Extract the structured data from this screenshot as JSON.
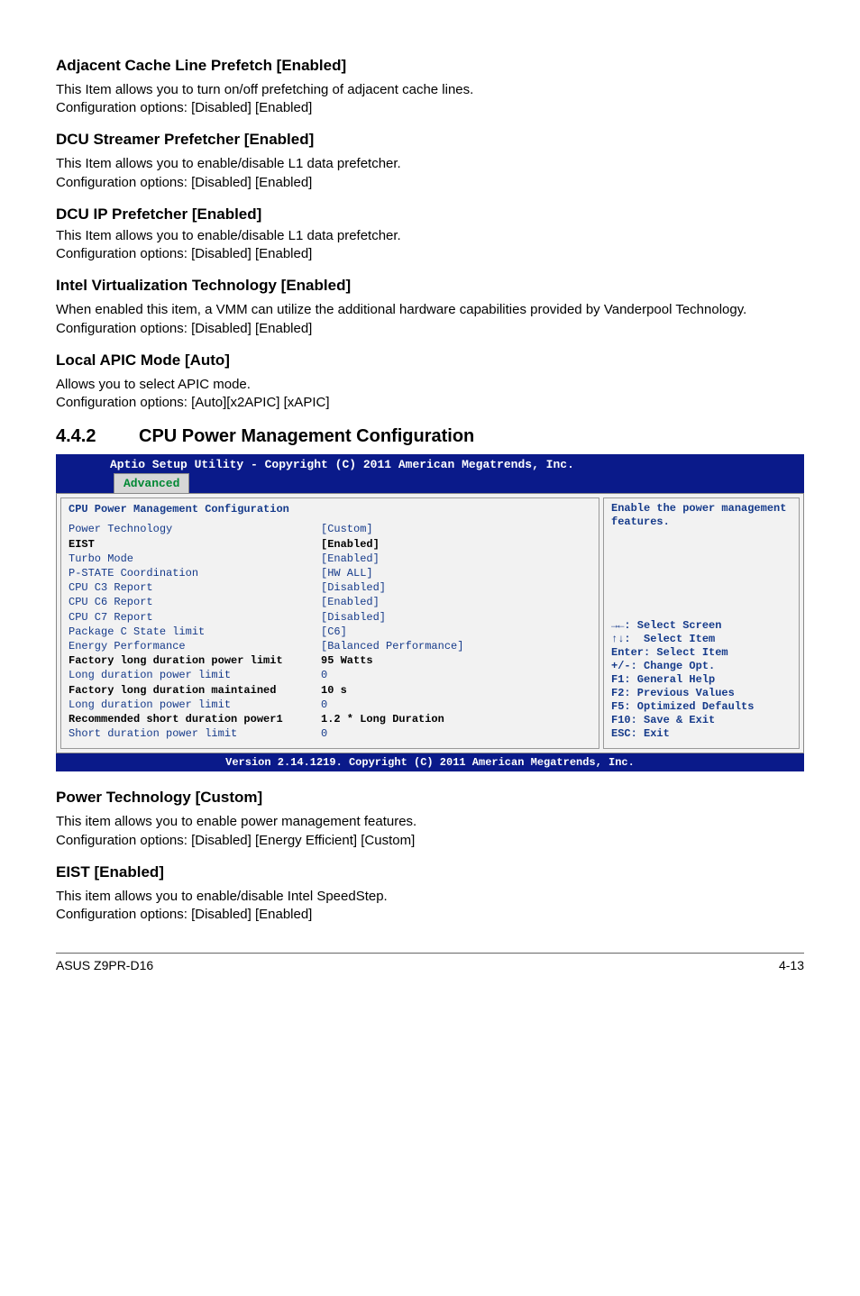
{
  "s1": {
    "h": "Adjacent Cache Line Prefetch [Enabled]",
    "p": "This Item allows you to turn on/off prefetching of adjacent cache lines.\nConfiguration options: [Disabled] [Enabled]"
  },
  "s2": {
    "h": "DCU Streamer Prefetcher [Enabled]",
    "p": "This Item allows you to enable/disable L1 data prefetcher.\nConfiguration options: [Disabled] [Enabled]"
  },
  "s3": {
    "h": "DCU IP Prefetcher [Enabled]",
    "p": "This Item allows you to enable/disable L1 data prefetcher.\nConfiguration options: [Disabled] [Enabled]"
  },
  "s4": {
    "h": "Intel Virtualization Technology [Enabled]",
    "p": "When enabled this item, a VMM can utilize the additional hardware capabilities provided by Vanderpool Technology.\nConfiguration options: [Disabled] [Enabled]"
  },
  "s5": {
    "h": "Local APIC Mode [Auto]",
    "p": "Allows you to select APIC mode.\nConfiguration options: [Auto][x2APIC] [xAPIC]"
  },
  "sec": {
    "num": "4.4.2",
    "title": "CPU Power Management Configuration"
  },
  "bios": {
    "top": "Aptio Setup Utility - Copyright (C) 2011 American Megatrends, Inc.",
    "tab": "Advanced",
    "panel_title": "CPU Power Management Configuration",
    "rows": [
      {
        "k": "Power Technology",
        "v": "[Custom]",
        "cls": "blue"
      },
      {
        "k": "EIST",
        "v": "[Enabled]",
        "cls": "boldline"
      },
      {
        "k": "Turbo Mode",
        "v": "[Enabled]",
        "cls": "blue"
      },
      {
        "k": "P-STATE Coordination",
        "v": "[HW ALL]",
        "cls": "blue"
      },
      {
        "k": "CPU C3 Report",
        "v": "[Disabled]",
        "cls": "blue"
      },
      {
        "k": "CPU C6 Report",
        "v": "[Enabled]",
        "cls": "blue"
      },
      {
        "k": "CPU C7 Report",
        "v": "[Disabled]",
        "cls": "blue"
      },
      {
        "k": "Package C State limit",
        "v": "[C6]",
        "cls": "blue"
      },
      {
        "k": "Energy Performance",
        "v": "[Balanced Performance]",
        "cls": "blue"
      },
      {
        "k": "Factory long duration power limit",
        "v": "95 Watts",
        "cls": "boldline"
      },
      {
        "k": "Long duration power limit",
        "v": "0",
        "cls": "blue"
      },
      {
        "k": "Factory long duration maintained",
        "v": "10 s",
        "cls": "boldline"
      },
      {
        "k": "Long duration power limit",
        "v": "0",
        "cls": "blue"
      },
      {
        "k": "Recommended short duration power1",
        "v": "1.2 * Long Duration",
        "cls": "boldline"
      },
      {
        "k": "Short duration power limit",
        "v": "0",
        "cls": "blue"
      }
    ],
    "help_top": "Enable the power management features.",
    "help_bot": "→←: Select Screen\n↑↓:  Select Item\nEnter: Select Item\n+/-: Change Opt.\nF1: General Help\nF2: Previous Values\nF5: Optimized Defaults\nF10: Save & Exit\nESC: Exit",
    "footer": "Version 2.14.1219. Copyright (C) 2011 American Megatrends, Inc."
  },
  "s6": {
    "h": "Power Technology [Custom]",
    "p": "This item allows you to enable power management features.\nConfiguration options: [Disabled] [Energy Efficient] [Custom]"
  },
  "s7": {
    "h": "EIST [Enabled]",
    "p": "This item allows you to enable/disable Intel SpeedStep.\nConfiguration options: [Disabled] [Enabled]"
  },
  "footer": {
    "left": "ASUS Z9PR-D16",
    "right": "4-13"
  }
}
